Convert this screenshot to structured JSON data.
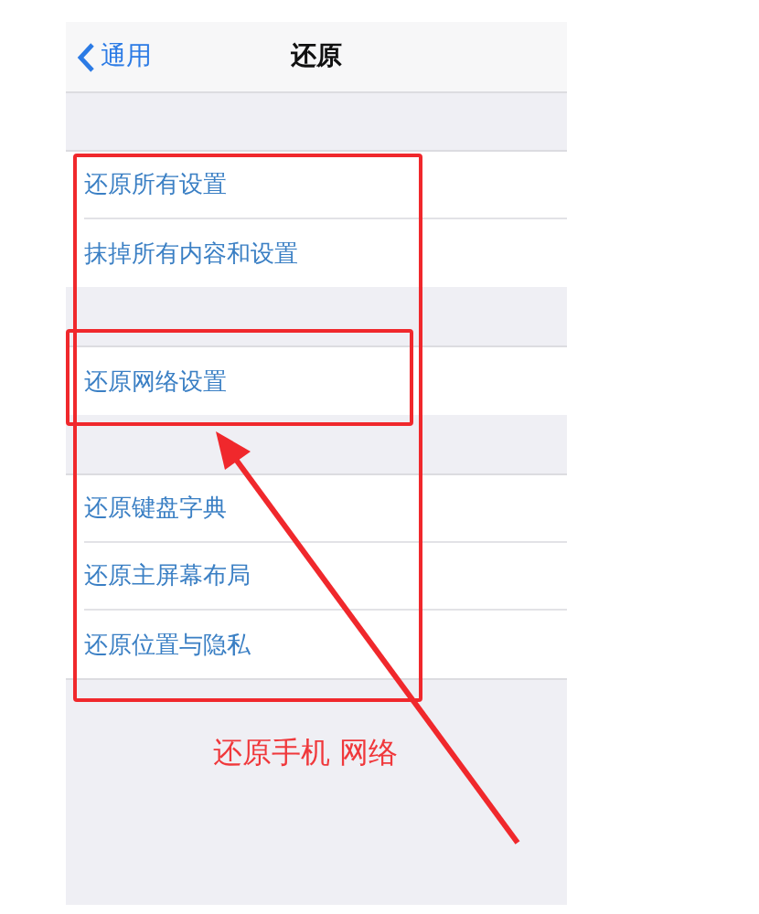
{
  "nav": {
    "back_label": "通用",
    "title": "还原"
  },
  "groups": [
    {
      "items": [
        {
          "label": "还原所有设置"
        },
        {
          "label": "抹掉所有内容和设置"
        }
      ]
    },
    {
      "items": [
        {
          "label": "还原网络设置"
        }
      ]
    },
    {
      "items": [
        {
          "label": "还原键盘字典"
        },
        {
          "label": "还原主屏幕布局"
        },
        {
          "label": "还原位置与隐私"
        }
      ]
    }
  ],
  "annotation": {
    "text": "还原手机 网络"
  }
}
